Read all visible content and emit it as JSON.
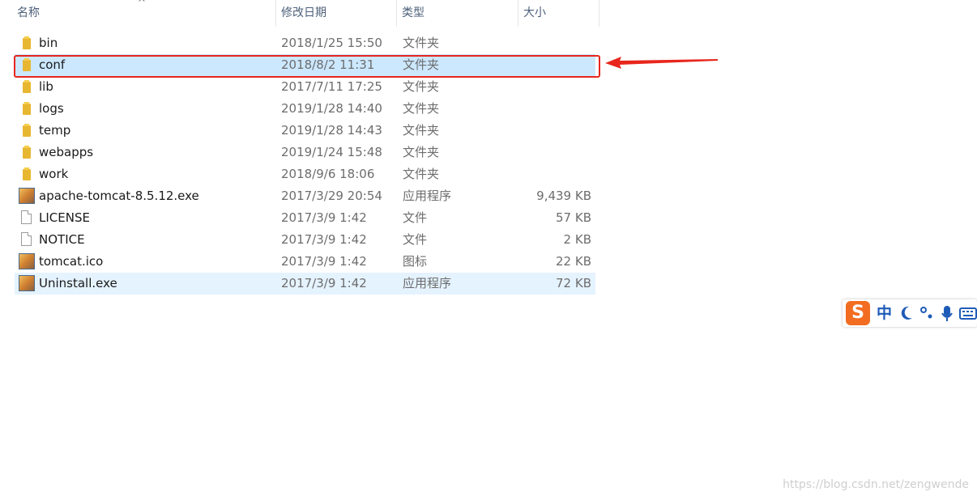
{
  "columns": {
    "name": "名称",
    "date": "修改日期",
    "type": "类型",
    "size": "大小"
  },
  "files": [
    {
      "name": "bin",
      "date": "2018/1/25 15:50",
      "type": "文件夹",
      "size": "",
      "icon": "folder-icon"
    },
    {
      "name": "conf",
      "date": "2018/8/2 11:31",
      "type": "文件夹",
      "size": "",
      "icon": "folder-icon"
    },
    {
      "name": "lib",
      "date": "2017/7/11 17:25",
      "type": "文件夹",
      "size": "",
      "icon": "folder-icon"
    },
    {
      "name": "logs",
      "date": "2019/1/28 14:40",
      "type": "文件夹",
      "size": "",
      "icon": "folder-icon"
    },
    {
      "name": "temp",
      "date": "2019/1/28 14:43",
      "type": "文件夹",
      "size": "",
      "icon": "folder-icon"
    },
    {
      "name": "webapps",
      "date": "2019/1/24 15:48",
      "type": "文件夹",
      "size": "",
      "icon": "folder-icon"
    },
    {
      "name": "work",
      "date": "2018/9/6 18:06",
      "type": "文件夹",
      "size": "",
      "icon": "folder-icon"
    },
    {
      "name": "apache-tomcat-8.5.12.exe",
      "date": "2017/3/29 20:54",
      "type": "应用程序",
      "size": "9,439 KB",
      "icon": "tomcat-app-icon"
    },
    {
      "name": "LICENSE",
      "date": "2017/3/9 1:42",
      "type": "文件",
      "size": "57 KB",
      "icon": "file-icon"
    },
    {
      "name": "NOTICE",
      "date": "2017/3/9 1:42",
      "type": "文件",
      "size": "2 KB",
      "icon": "file-icon"
    },
    {
      "name": "tomcat.ico",
      "date": "2017/3/9 1:42",
      "type": "图标",
      "size": "22 KB",
      "icon": "tomcat-app-icon"
    },
    {
      "name": "Uninstall.exe",
      "date": "2017/3/9 1:42",
      "type": "应用程序",
      "size": "72 KB",
      "icon": "tomcat-app-icon"
    }
  ],
  "selected_row": "conf",
  "hover_row": "Uninstall.exe",
  "colors": {
    "selected": "#cce8ff",
    "hover": "#e5f3ff",
    "annotation": "#e8261c"
  },
  "ime_bar": {
    "logo": "S",
    "mode": "中"
  },
  "watermark": "https://blog.csdn.net/zengwende"
}
